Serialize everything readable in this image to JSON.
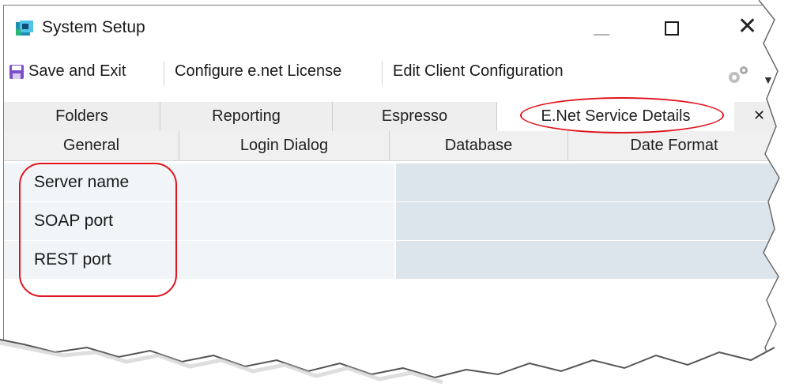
{
  "window": {
    "title": "System Setup"
  },
  "toolbar": {
    "save_label": "Save and Exit",
    "license_label": "Configure e.net License",
    "client_config_label": "Edit Client Configuration"
  },
  "tabs_row1": [
    "Folders",
    "Reporting",
    "Espresso",
    "E.Net Service Details"
  ],
  "tabs_row2": [
    "General",
    "Login Dialog",
    "Database",
    "Date Format"
  ],
  "active_tab": "E.Net Service Details",
  "properties": [
    {
      "label": "Server name",
      "value": ""
    },
    {
      "label": "SOAP port",
      "value": ""
    },
    {
      "label": "REST port",
      "value": ""
    }
  ],
  "colors": {
    "highlight": "#e0141e",
    "value_cell": "#dde5ec",
    "label_cell": "#f1f5f8",
    "icon_accent": "#2a9fd6"
  }
}
